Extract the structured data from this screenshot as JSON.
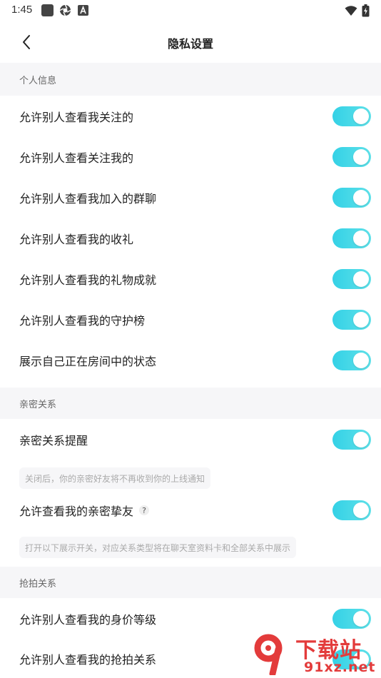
{
  "status_bar": {
    "time": "1:45"
  },
  "nav": {
    "title": "隐私设置"
  },
  "sections": {
    "personal": {
      "title": "个人信息",
      "items": [
        {
          "label": "允许别人查看我关注的",
          "on": true
        },
        {
          "label": "允许别人查看关注我的",
          "on": true
        },
        {
          "label": "允许别人查看我加入的群聊",
          "on": true
        },
        {
          "label": "允许别人查看我的收礼",
          "on": true
        },
        {
          "label": "允许别人查看我的礼物成就",
          "on": true
        },
        {
          "label": "允许别人查看我的守护榜",
          "on": true
        },
        {
          "label": "展示自己正在房间中的状态",
          "on": true
        }
      ]
    },
    "intimate": {
      "title": "亲密关系",
      "items": [
        {
          "label": "亲密关系提醒",
          "on": true
        },
        {
          "label": "允许查看我的亲密挚友",
          "on": true
        }
      ],
      "notes": [
        "关闭后，你的亲密好友将不再收到你的上线通知",
        "打开以下展示开关，对应关系类型将在聊天室资料卡和全部关系中展示"
      ],
      "help_mark": "?"
    },
    "grab": {
      "title": "抢拍关系",
      "items": [
        {
          "label": "允许别人查看我的身价等级",
          "on": true
        },
        {
          "label": "允许别人查看我的抢拍关系",
          "on": true
        }
      ]
    }
  },
  "watermark": {
    "brand": "下载站",
    "url": "91xz.net"
  },
  "colors": {
    "accent": "#3fd5e7",
    "section_bg": "#f6f6f8",
    "watermark": "#e33b3b"
  }
}
